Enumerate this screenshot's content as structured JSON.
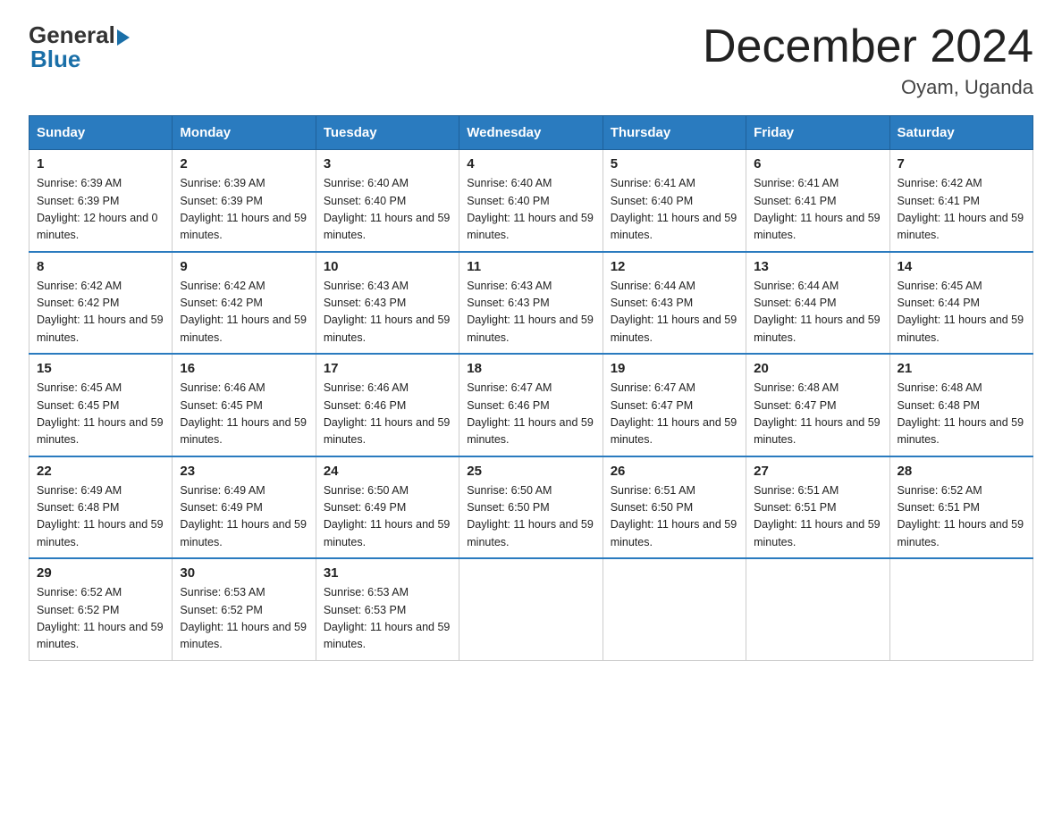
{
  "logo": {
    "general": "General",
    "blue": "Blue"
  },
  "title": "December 2024",
  "location": "Oyam, Uganda",
  "days_of_week": [
    "Sunday",
    "Monday",
    "Tuesday",
    "Wednesday",
    "Thursday",
    "Friday",
    "Saturday"
  ],
  "weeks": [
    [
      {
        "day": "1",
        "sunrise": "6:39 AM",
        "sunset": "6:39 PM",
        "daylight": "12 hours and 0 minutes."
      },
      {
        "day": "2",
        "sunrise": "6:39 AM",
        "sunset": "6:39 PM",
        "daylight": "11 hours and 59 minutes."
      },
      {
        "day": "3",
        "sunrise": "6:40 AM",
        "sunset": "6:40 PM",
        "daylight": "11 hours and 59 minutes."
      },
      {
        "day": "4",
        "sunrise": "6:40 AM",
        "sunset": "6:40 PM",
        "daylight": "11 hours and 59 minutes."
      },
      {
        "day": "5",
        "sunrise": "6:41 AM",
        "sunset": "6:40 PM",
        "daylight": "11 hours and 59 minutes."
      },
      {
        "day": "6",
        "sunrise": "6:41 AM",
        "sunset": "6:41 PM",
        "daylight": "11 hours and 59 minutes."
      },
      {
        "day": "7",
        "sunrise": "6:42 AM",
        "sunset": "6:41 PM",
        "daylight": "11 hours and 59 minutes."
      }
    ],
    [
      {
        "day": "8",
        "sunrise": "6:42 AM",
        "sunset": "6:42 PM",
        "daylight": "11 hours and 59 minutes."
      },
      {
        "day": "9",
        "sunrise": "6:42 AM",
        "sunset": "6:42 PM",
        "daylight": "11 hours and 59 minutes."
      },
      {
        "day": "10",
        "sunrise": "6:43 AM",
        "sunset": "6:43 PM",
        "daylight": "11 hours and 59 minutes."
      },
      {
        "day": "11",
        "sunrise": "6:43 AM",
        "sunset": "6:43 PM",
        "daylight": "11 hours and 59 minutes."
      },
      {
        "day": "12",
        "sunrise": "6:44 AM",
        "sunset": "6:43 PM",
        "daylight": "11 hours and 59 minutes."
      },
      {
        "day": "13",
        "sunrise": "6:44 AM",
        "sunset": "6:44 PM",
        "daylight": "11 hours and 59 minutes."
      },
      {
        "day": "14",
        "sunrise": "6:45 AM",
        "sunset": "6:44 PM",
        "daylight": "11 hours and 59 minutes."
      }
    ],
    [
      {
        "day": "15",
        "sunrise": "6:45 AM",
        "sunset": "6:45 PM",
        "daylight": "11 hours and 59 minutes."
      },
      {
        "day": "16",
        "sunrise": "6:46 AM",
        "sunset": "6:45 PM",
        "daylight": "11 hours and 59 minutes."
      },
      {
        "day": "17",
        "sunrise": "6:46 AM",
        "sunset": "6:46 PM",
        "daylight": "11 hours and 59 minutes."
      },
      {
        "day": "18",
        "sunrise": "6:47 AM",
        "sunset": "6:46 PM",
        "daylight": "11 hours and 59 minutes."
      },
      {
        "day": "19",
        "sunrise": "6:47 AM",
        "sunset": "6:47 PM",
        "daylight": "11 hours and 59 minutes."
      },
      {
        "day": "20",
        "sunrise": "6:48 AM",
        "sunset": "6:47 PM",
        "daylight": "11 hours and 59 minutes."
      },
      {
        "day": "21",
        "sunrise": "6:48 AM",
        "sunset": "6:48 PM",
        "daylight": "11 hours and 59 minutes."
      }
    ],
    [
      {
        "day": "22",
        "sunrise": "6:49 AM",
        "sunset": "6:48 PM",
        "daylight": "11 hours and 59 minutes."
      },
      {
        "day": "23",
        "sunrise": "6:49 AM",
        "sunset": "6:49 PM",
        "daylight": "11 hours and 59 minutes."
      },
      {
        "day": "24",
        "sunrise": "6:50 AM",
        "sunset": "6:49 PM",
        "daylight": "11 hours and 59 minutes."
      },
      {
        "day": "25",
        "sunrise": "6:50 AM",
        "sunset": "6:50 PM",
        "daylight": "11 hours and 59 minutes."
      },
      {
        "day": "26",
        "sunrise": "6:51 AM",
        "sunset": "6:50 PM",
        "daylight": "11 hours and 59 minutes."
      },
      {
        "day": "27",
        "sunrise": "6:51 AM",
        "sunset": "6:51 PM",
        "daylight": "11 hours and 59 minutes."
      },
      {
        "day": "28",
        "sunrise": "6:52 AM",
        "sunset": "6:51 PM",
        "daylight": "11 hours and 59 minutes."
      }
    ],
    [
      {
        "day": "29",
        "sunrise": "6:52 AM",
        "sunset": "6:52 PM",
        "daylight": "11 hours and 59 minutes."
      },
      {
        "day": "30",
        "sunrise": "6:53 AM",
        "sunset": "6:52 PM",
        "daylight": "11 hours and 59 minutes."
      },
      {
        "day": "31",
        "sunrise": "6:53 AM",
        "sunset": "6:53 PM",
        "daylight": "11 hours and 59 minutes."
      },
      null,
      null,
      null,
      null
    ]
  ]
}
